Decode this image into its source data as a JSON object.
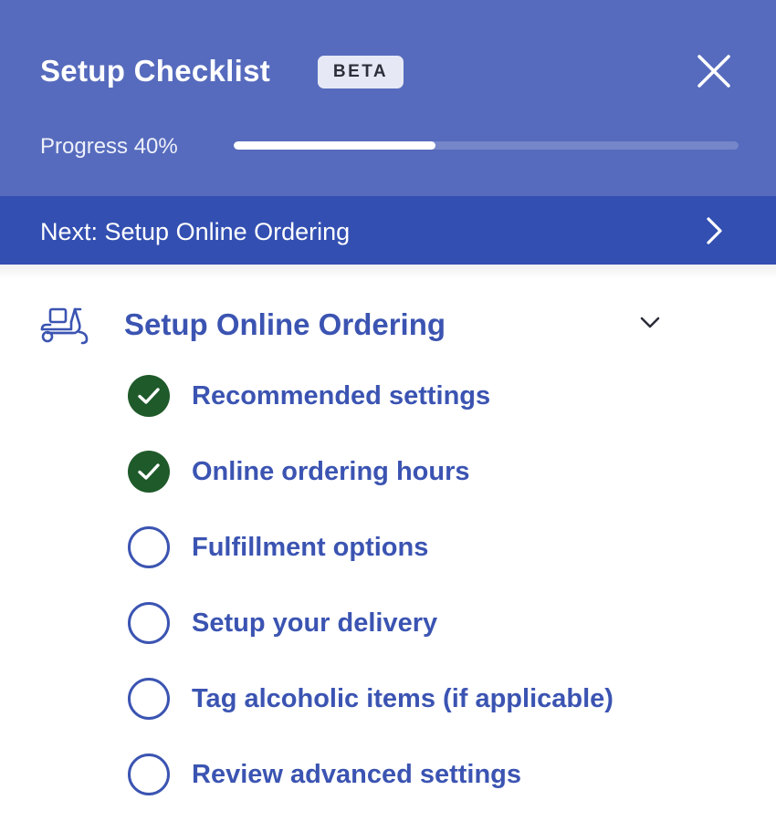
{
  "header": {
    "title": "Setup Checklist",
    "badge": "BETA",
    "close_icon": "close-icon",
    "progress": {
      "label": "Progress 40%",
      "value": 0.4
    }
  },
  "next": {
    "label": "Next: Setup Online Ordering",
    "icon": "chevron-right-icon"
  },
  "section": {
    "icon": "scooter-icon",
    "title": "Setup Online Ordering",
    "toggle_icon": "chevron-down-icon",
    "items": [
      {
        "label": "Recommended settings",
        "done": true
      },
      {
        "label": "Online ordering hours",
        "done": true
      },
      {
        "label": "Fulfillment options",
        "done": false
      },
      {
        "label": "Setup your delivery",
        "done": false
      },
      {
        "label": "Tag alcoholic items (if applicable)",
        "done": false
      },
      {
        "label": "Review advanced settings",
        "done": false
      }
    ]
  },
  "colors": {
    "header_bg": "#566bbd",
    "next_bar_bg": "#334fb1",
    "accent_text": "#3b54b2",
    "check_done": "#1f5a2a"
  }
}
